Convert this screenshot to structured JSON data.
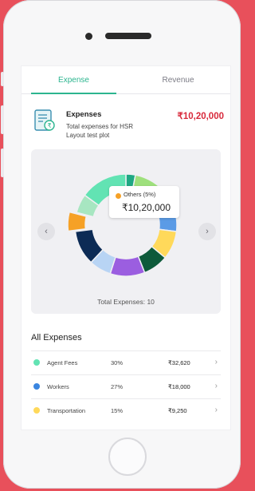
{
  "tabs": [
    {
      "label": "Expense",
      "active": true
    },
    {
      "label": "Revenue",
      "active": false
    }
  ],
  "summary": {
    "title": "Expenses",
    "description": "Total expenses for HSR Layout test plot",
    "amount": "₹10,20,000",
    "icon": "expense-report-icon"
  },
  "chart_data": {
    "type": "pie",
    "segments": [
      {
        "color": "#1fa883",
        "share": 3
      },
      {
        "color": "#9ee07c",
        "share": 12
      },
      {
        "color": "#5b9be6",
        "share": 12
      },
      {
        "color": "#ffd95a",
        "share": 9
      },
      {
        "color": "#0d5a3a",
        "share": 8
      },
      {
        "color": "#9b5ee0",
        "share": 11
      },
      {
        "color": "#b8d4f4",
        "share": 7
      },
      {
        "color": "#0c2b55",
        "share": 11
      },
      {
        "color": "#f6a126",
        "share": 6
      },
      {
        "color": "#a7e6c1",
        "share": 6
      },
      {
        "color": "#62e3b3",
        "share": 15
      }
    ],
    "highlight_index": 8,
    "tooltip": {
      "label": "Others (5%)",
      "value": "₹10,20,000"
    },
    "caption": "Total Expenses: 10"
  },
  "nav": {
    "prev": "‹",
    "next": "›"
  },
  "all_expenses": {
    "title": "All Expenses",
    "rows": [
      {
        "name": "Agent Fees",
        "percent": "30%",
        "amount": "₹32,620",
        "color": "#62e3b3"
      },
      {
        "name": "Workers",
        "percent": "27%",
        "amount": "₹18,000",
        "color": "#3b86e0"
      },
      {
        "name": "Transportation",
        "percent": "15%",
        "amount": "₹9,250",
        "color": "#ffd95a"
      }
    ]
  },
  "colors": {
    "accent": "#2cb58f",
    "amount_red": "#d8293b",
    "frame": "#e8505b"
  }
}
